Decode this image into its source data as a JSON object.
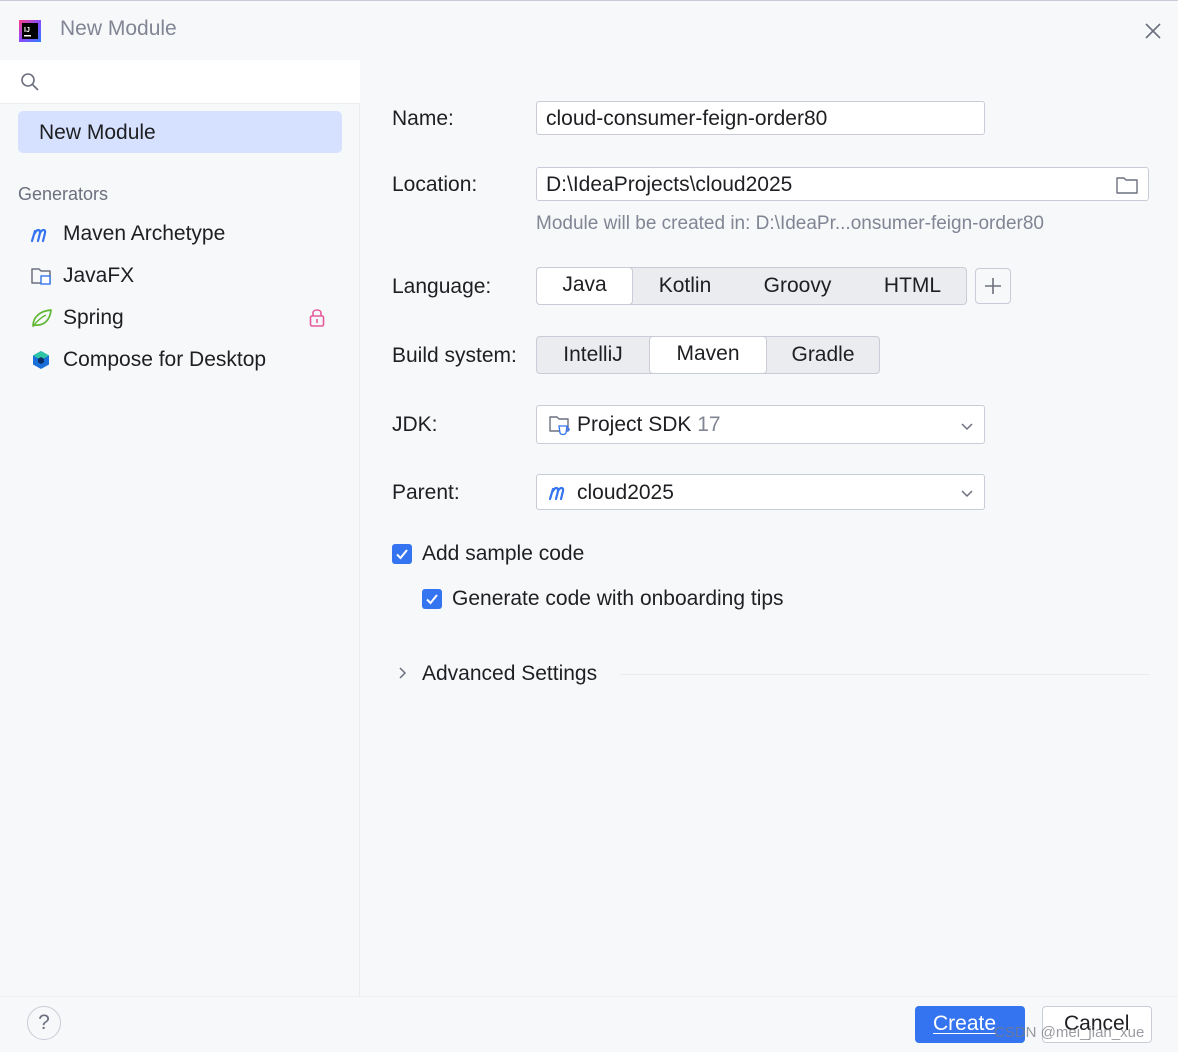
{
  "window": {
    "title": "New Module",
    "app_icon": "intellij-idea-icon"
  },
  "sidebar": {
    "search": {
      "value": "",
      "placeholder": ""
    },
    "selected_item": "New Module",
    "section_label": "Generators",
    "generators": [
      {
        "label": "Maven Archetype",
        "icon": "maven-icon"
      },
      {
        "label": "JavaFX",
        "icon": "javafx-folder-icon"
      },
      {
        "label": "Spring",
        "icon": "spring-leaf-icon",
        "locked": true
      },
      {
        "label": "Compose for Desktop",
        "icon": "compose-icon"
      }
    ]
  },
  "form": {
    "name": {
      "label": "Name:",
      "value": "cloud-consumer-feign-order80"
    },
    "location": {
      "label": "Location:",
      "value": "D:\\IdeaProjects\\cloud2025",
      "hint": "Module will be created in: D:\\IdeaPr...onsumer-feign-order80"
    },
    "language": {
      "label": "Language:",
      "options": [
        "Java",
        "Kotlin",
        "Groovy",
        "HTML"
      ],
      "selected": "Java"
    },
    "build_system": {
      "label": "Build system:",
      "options": [
        "IntelliJ",
        "Maven",
        "Gradle"
      ],
      "selected": "Maven"
    },
    "jdk": {
      "label": "JDK:",
      "value": "Project SDK",
      "version": "17"
    },
    "parent": {
      "label": "Parent:",
      "value": "cloud2025"
    },
    "add_sample_code": {
      "label": "Add sample code",
      "checked": true
    },
    "onboarding_tips": {
      "label": "Generate code with onboarding tips",
      "checked": true
    },
    "advanced_settings": {
      "label": "Advanced Settings",
      "expanded": false
    }
  },
  "footer": {
    "help_label": "?",
    "create_label": "Create",
    "cancel_label": "Cancel",
    "watermark": "CSDN @mei_jian_xue"
  },
  "colors": {
    "accent": "#3574f0",
    "selection": "#d5e1ff",
    "maven": "#3574f0",
    "spring": "#5fb832",
    "lock": "#e55b9b"
  }
}
